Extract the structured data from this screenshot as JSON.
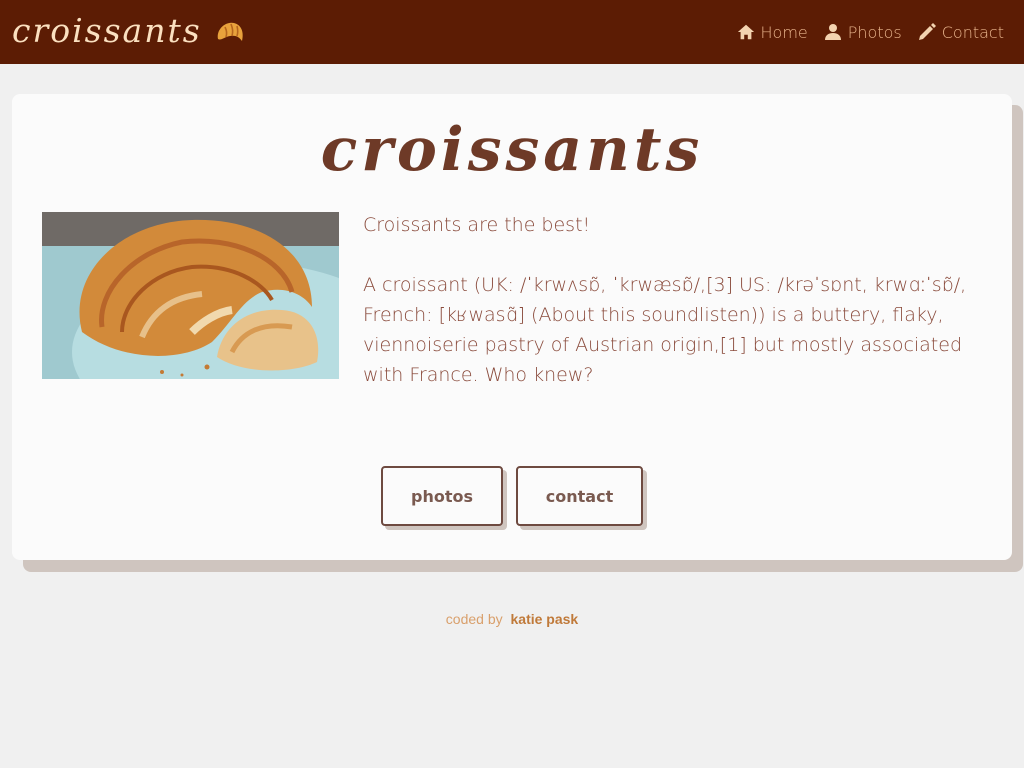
{
  "brand": {
    "name": "croissants",
    "logo_icon": "croissant-icon"
  },
  "nav": [
    {
      "label": "Home",
      "icon": "home-icon"
    },
    {
      "label": "Photos",
      "icon": "user-icon"
    },
    {
      "label": "Contact",
      "icon": "pencil-icon"
    }
  ],
  "main": {
    "title": "croissants",
    "intro": "Croissants are the best!",
    "description": "A croissant (UK: /ˈkrwʌsɒ̃, ˈkrwæsɒ̃/,[3] US: /krəˈsɒnt, krwɑːˈsɒ̃/, French: [kʁwasɑ̃] (About this soundlisten)) is a buttery, flaky, viennoiserie pastry of Austrian origin,[1] but mostly associated with France. Who knew?",
    "buttons": {
      "photos": "photos",
      "contact": "contact"
    }
  },
  "footer": {
    "prefix": "coded by",
    "author": "katie pask"
  },
  "colors": {
    "navbar": "#5c1c04",
    "brand_text": "#fbe0c0",
    "nav_link": "#e9b48c",
    "page_bg": "#f0f0f0",
    "card_bg": "#fbfbfb",
    "title": "#6e3a27",
    "body_text": "#8a4b3c",
    "footer_link": "#c07a3a"
  }
}
